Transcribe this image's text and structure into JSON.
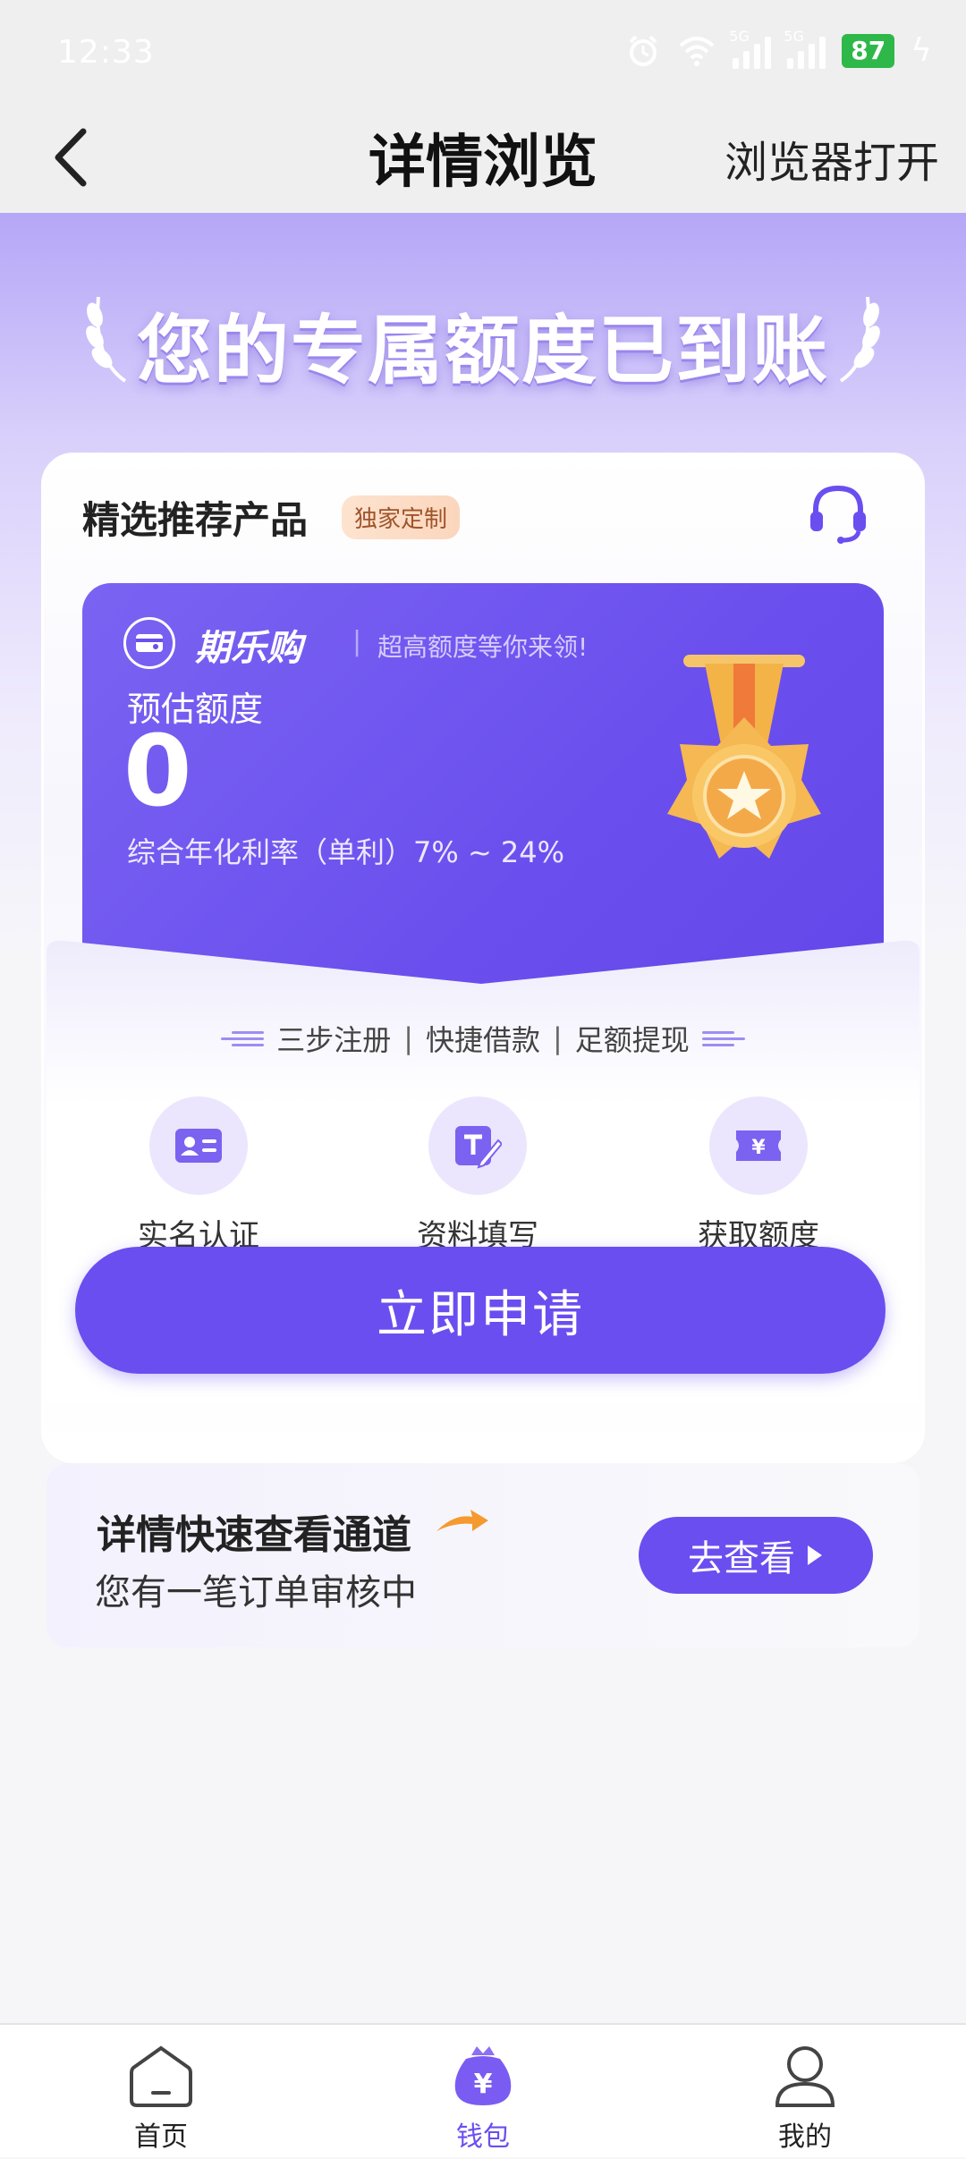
{
  "status_bar": {
    "time": "12:33",
    "battery": "87",
    "network_1": "5G",
    "network_2": "5G"
  },
  "nav": {
    "title": "详情浏览",
    "open_browser": "浏览器打开"
  },
  "hero": {
    "title": "您的专属额度已到账"
  },
  "card": {
    "heading": "精选推荐产品",
    "tag": "独家定制"
  },
  "product": {
    "name": "期乐购",
    "slogan": "超高额度等你来领!",
    "estimate_label": "预估额度",
    "estimate_value": "0",
    "rate": "综合年化利率（单利）7% ~ 24%"
  },
  "steps": {
    "title_parts": [
      "三步注册",
      "快捷借款",
      "足额提现"
    ],
    "items": [
      {
        "label": "实名认证",
        "icon": "id-card-icon"
      },
      {
        "label": "资料填写",
        "icon": "edit-form-icon"
      },
      {
        "label": "获取额度",
        "icon": "yuan-ticket-icon"
      }
    ]
  },
  "apply_button": "立即申请",
  "quick": {
    "title": "详情快速查看通道",
    "subtitle": "您有一笔订单审核中",
    "button": "去查看"
  },
  "tabs": [
    {
      "label": "首页",
      "icon": "home-icon",
      "active": false
    },
    {
      "label": "钱包",
      "icon": "wallet-icon",
      "active": true
    },
    {
      "label": "我的",
      "icon": "profile-icon",
      "active": false
    }
  ],
  "colors": {
    "primary": "#6a4ef0",
    "accent_tag": "#a0542a",
    "battery": "#2fb84a"
  }
}
